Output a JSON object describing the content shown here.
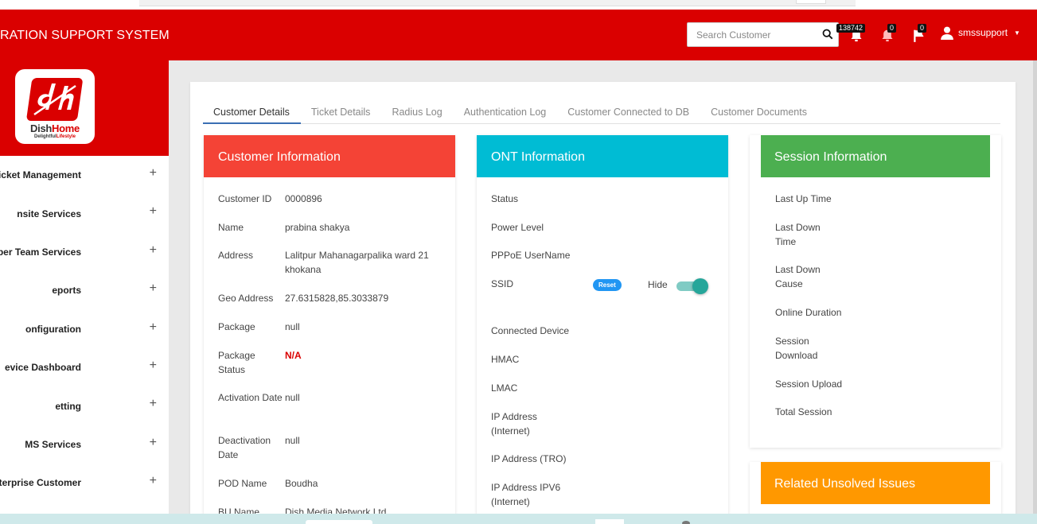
{
  "header": {
    "title": "RATION SUPPORT SYSTEM",
    "search_placeholder": "Search Customer",
    "badges": {
      "notifications": "138742",
      "alerts": "0",
      "flags": "0"
    },
    "username": "smssupport"
  },
  "logo": {
    "name_a": "Dish",
    "name_b": "Home",
    "tag_a": "Delightful",
    "tag_b": "Lifestyle"
  },
  "sidebar": {
    "items": [
      {
        "label": "icket Management"
      },
      {
        "label": "nsite Services"
      },
      {
        "label": "ber Team Services"
      },
      {
        "label": "eports"
      },
      {
        "label": "onfiguration"
      },
      {
        "label": "evice Dashboard"
      },
      {
        "label": "etting"
      },
      {
        "label": "MS Services"
      },
      {
        "label": "nterprise Customer"
      }
    ],
    "plus": "+"
  },
  "tabs": [
    "Customer Details",
    "Ticket Details",
    "Radius Log",
    "Authentication Log",
    "Customer Connected to DB",
    "Customer Documents"
  ],
  "customer": {
    "title": "Customer Information",
    "rows": [
      {
        "k": "Customer ID",
        "v": "0000896"
      },
      {
        "k": "Name",
        "v": "prabina shakya"
      },
      {
        "k": "Address",
        "v": "Lalitpur Mahanagarpalika ward 21 khokana"
      },
      {
        "k": "Geo Address",
        "v": "27.6315828,85.3033879"
      },
      {
        "k": "Package",
        "v": "null"
      },
      {
        "k": "Package Status",
        "v": "N/A"
      },
      {
        "k": "Activation Date",
        "v": "null"
      },
      {
        "k": "Deactivation Date",
        "v": "null"
      },
      {
        "k": "POD Name",
        "v": "Boudha"
      },
      {
        "k": "BU Name",
        "v": "Dish Media Network Ltd"
      }
    ]
  },
  "ont": {
    "title": "ONT Information",
    "rows": [
      "Status",
      "Power Level",
      "PPPoE UserName",
      "SSID",
      "Connected Device",
      "HMAC",
      "LMAC",
      "IP Address (Internet)",
      "IP Address (TRO)",
      "IP Address IPV6 (Internet)"
    ],
    "reset_label": "Reset",
    "hide_label": "Hide"
  },
  "session": {
    "title": "Session Information",
    "rows": [
      "Last Up Time",
      "Last Down Time",
      "Last Down Cause",
      "Online Duration",
      "Session Download",
      "Session Upload",
      "Total Session"
    ]
  },
  "issues": {
    "title": "Related Unsolved Issues"
  },
  "colors": {
    "header": "#da0000",
    "customer": "#f44336",
    "ont": "#00bcd4",
    "session": "#4caf50",
    "issues": "#ff9800",
    "toggle": "#26a69a"
  }
}
